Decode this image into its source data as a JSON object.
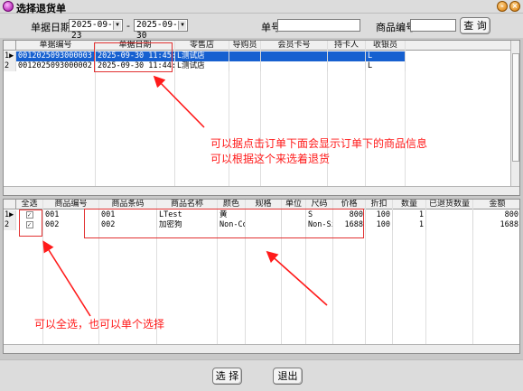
{
  "window": {
    "title": "选择退货单"
  },
  "filters": {
    "date_label": "单据日期",
    "date_from": "2025-09-23",
    "date_sep": "-",
    "date_to": "2025-09-30",
    "doc_no_label": "单号",
    "doc_no_value": "",
    "product_no_label": "商品编号",
    "product_no_value": "",
    "query_label": "查 询"
  },
  "orders": {
    "columns": [
      "单据编号",
      "单据日期",
      "零售店",
      "导购员",
      "会员卡号",
      "持卡人",
      "收银员"
    ],
    "rows": [
      {
        "idx": "1",
        "marker": "▶",
        "doc_no": "0012025093000003",
        "date": "2025-09-30 11:45:31",
        "store": "L测试店",
        "guide": "",
        "member": "",
        "holder": "",
        "cashier": "L"
      },
      {
        "idx": "2",
        "marker": "",
        "doc_no": "0012025093000002",
        "date": "2025-09-30 11:44:07",
        "store": "L测试店",
        "guide": "",
        "member": "",
        "holder": "",
        "cashier": "L"
      }
    ]
  },
  "items": {
    "columns": [
      "全选",
      "商品编号",
      "商品条码",
      "商品名称",
      "颜色",
      "规格",
      "单位",
      "尺码",
      "价格",
      "折扣",
      "数量",
      "已退货数量",
      "金额"
    ],
    "rows": [
      {
        "idx": "1",
        "marker": "▶",
        "checked": "✓",
        "pno": "001",
        "barcode": "001",
        "name": "LTest",
        "color": "黄",
        "spec": "",
        "unit": "",
        "size": "S",
        "price": "800",
        "discount": "100",
        "qty": "1",
        "returned": "",
        "amount": "800"
      },
      {
        "idx": "2",
        "marker": "",
        "checked": "✓",
        "pno": "002",
        "barcode": "002",
        "name": "加密狗",
        "color": "Non-Col",
        "spec": "",
        "unit": "",
        "size": "Non-Si:",
        "price": "1688",
        "discount": "100",
        "qty": "1",
        "returned": "",
        "amount": "1688"
      }
    ]
  },
  "annotations": {
    "note1_line1": "可以据点击订单下面会显示订单下的商品信息",
    "note1_line2": "可以根据这个来选着退货",
    "note2": "可以全选，也可以单个选择",
    "color": "#ff1a1a"
  },
  "footer": {
    "select_label": "选 择",
    "exit_label": "退出"
  }
}
